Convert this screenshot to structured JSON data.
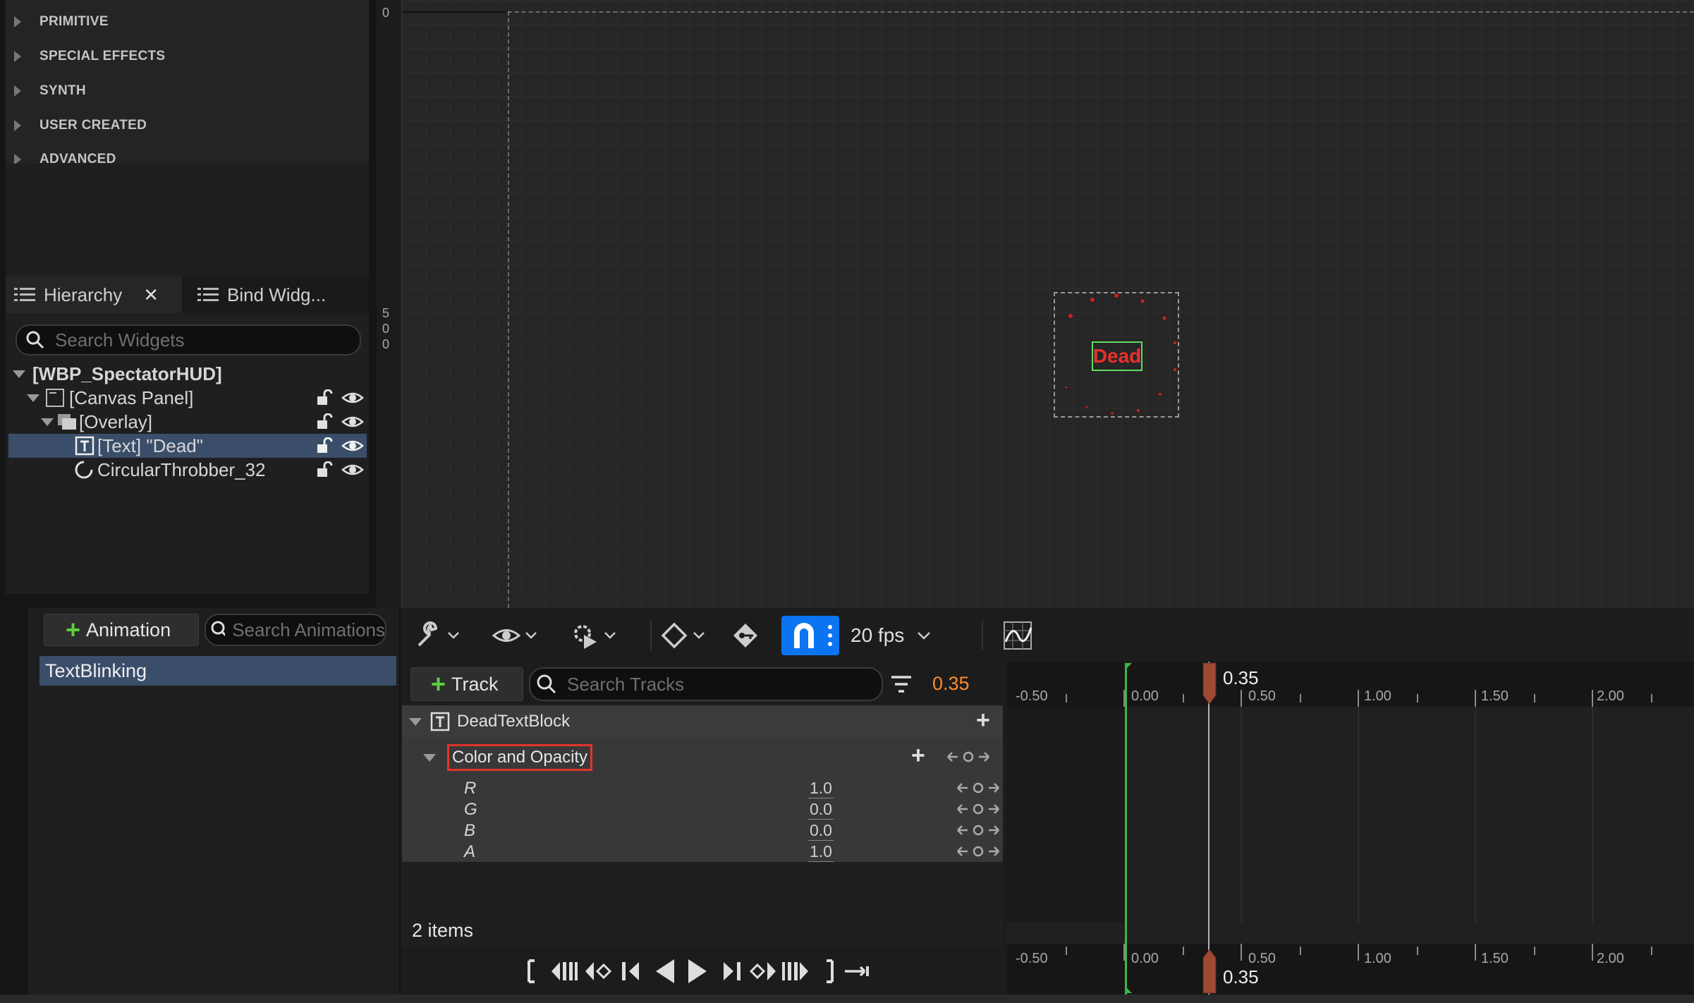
{
  "palette": {
    "categories": [
      "PRIMITIVE",
      "SPECIAL EFFECTS",
      "SYNTH",
      "USER CREATED",
      "ADVANCED"
    ]
  },
  "hierarchy_panel": {
    "tabs": [
      {
        "label": "Hierarchy",
        "icon": "list-icon",
        "active": true
      },
      {
        "label": "Bind Widg...",
        "icon": "list-icon",
        "active": false
      }
    ],
    "search_placeholder": "Search Widgets",
    "tree": [
      {
        "label": "[WBP_SpectatorHUD]",
        "depth": 0,
        "expanded": true,
        "icon": "",
        "bold": true
      },
      {
        "label": "[Canvas Panel]",
        "depth": 1,
        "expanded": true,
        "icon": "canvas-panel-icon"
      },
      {
        "label": "[Overlay]",
        "depth": 2,
        "expanded": true,
        "icon": "overlay-icon"
      },
      {
        "label": "[Text] \"Dead\"",
        "depth": 3,
        "icon": "text-icon",
        "selected": true
      },
      {
        "label": "CircularThrobber_32",
        "depth": 3,
        "icon": "throbber-icon"
      }
    ]
  },
  "designer": {
    "ruler_labels": [
      "0",
      "5",
      "0",
      "0"
    ],
    "canvas_text": "Dead"
  },
  "animations": {
    "add_button": "Animation",
    "search_placeholder": "Search Animations",
    "items": [
      "TextBlinking"
    ]
  },
  "sequencer": {
    "fps": "20 fps",
    "add_track_button": "Track",
    "search_placeholder": "Search Tracks",
    "current_time": "0.35",
    "track": "DeadTextBlock",
    "property": "Color and Opacity",
    "channels": [
      {
        "name": "R",
        "value": "1.0"
      },
      {
        "name": "G",
        "value": "0.0"
      },
      {
        "name": "B",
        "value": "0.0"
      },
      {
        "name": "A",
        "value": "1.0"
      }
    ],
    "item_count": "2 items",
    "ticks": [
      "-0.50",
      "0.00",
      "0.50",
      "1.00",
      "1.50",
      "2.00"
    ],
    "playhead": "0.35",
    "colors": {
      "accent": "#0b74f0",
      "playhead": "#a04a36",
      "time_orange": "#ff8a2a",
      "start_green": "#3cb44b"
    }
  }
}
